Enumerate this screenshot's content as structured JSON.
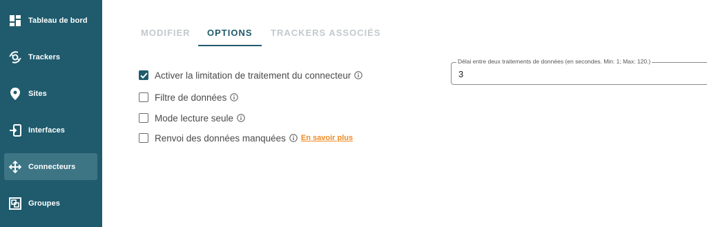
{
  "sidebar": {
    "items": [
      {
        "label": "Tableau de bord",
        "icon": "dashboard-icon",
        "active": false
      },
      {
        "label": "Trackers",
        "icon": "trackers-icon",
        "active": false
      },
      {
        "label": "Sites",
        "icon": "location-pin-icon",
        "active": false
      },
      {
        "label": "Interfaces",
        "icon": "interfaces-icon",
        "active": false
      },
      {
        "label": "Connecteurs",
        "icon": "connectors-icon",
        "active": true
      },
      {
        "label": "Groupes",
        "icon": "groups-icon",
        "active": false
      }
    ],
    "background": "#1f5b6d",
    "active_background": "#3d7585"
  },
  "tabs": [
    {
      "label": "MODIFIER",
      "active": false
    },
    {
      "label": "OPTIONS",
      "active": true
    },
    {
      "label": "TRACKERS ASSOCIÉS",
      "active": false
    }
  ],
  "options": [
    {
      "label": "Activer la limitation de traitement du connecteur",
      "checked": true
    },
    {
      "label": "Filtre de données",
      "checked": false
    },
    {
      "label": "Mode lecture seule",
      "checked": false
    },
    {
      "label": "Renvoi des données manquées",
      "checked": false,
      "link": "En savoir plus"
    }
  ],
  "delay_field": {
    "legend": "Délai entre deux traitements de données (en secondes. Min: 1; Max: 120.)",
    "value": "3"
  },
  "colors": {
    "accent": "#215a6b",
    "link": "#f08a24",
    "inactive_tab": "#c4c9cc"
  }
}
